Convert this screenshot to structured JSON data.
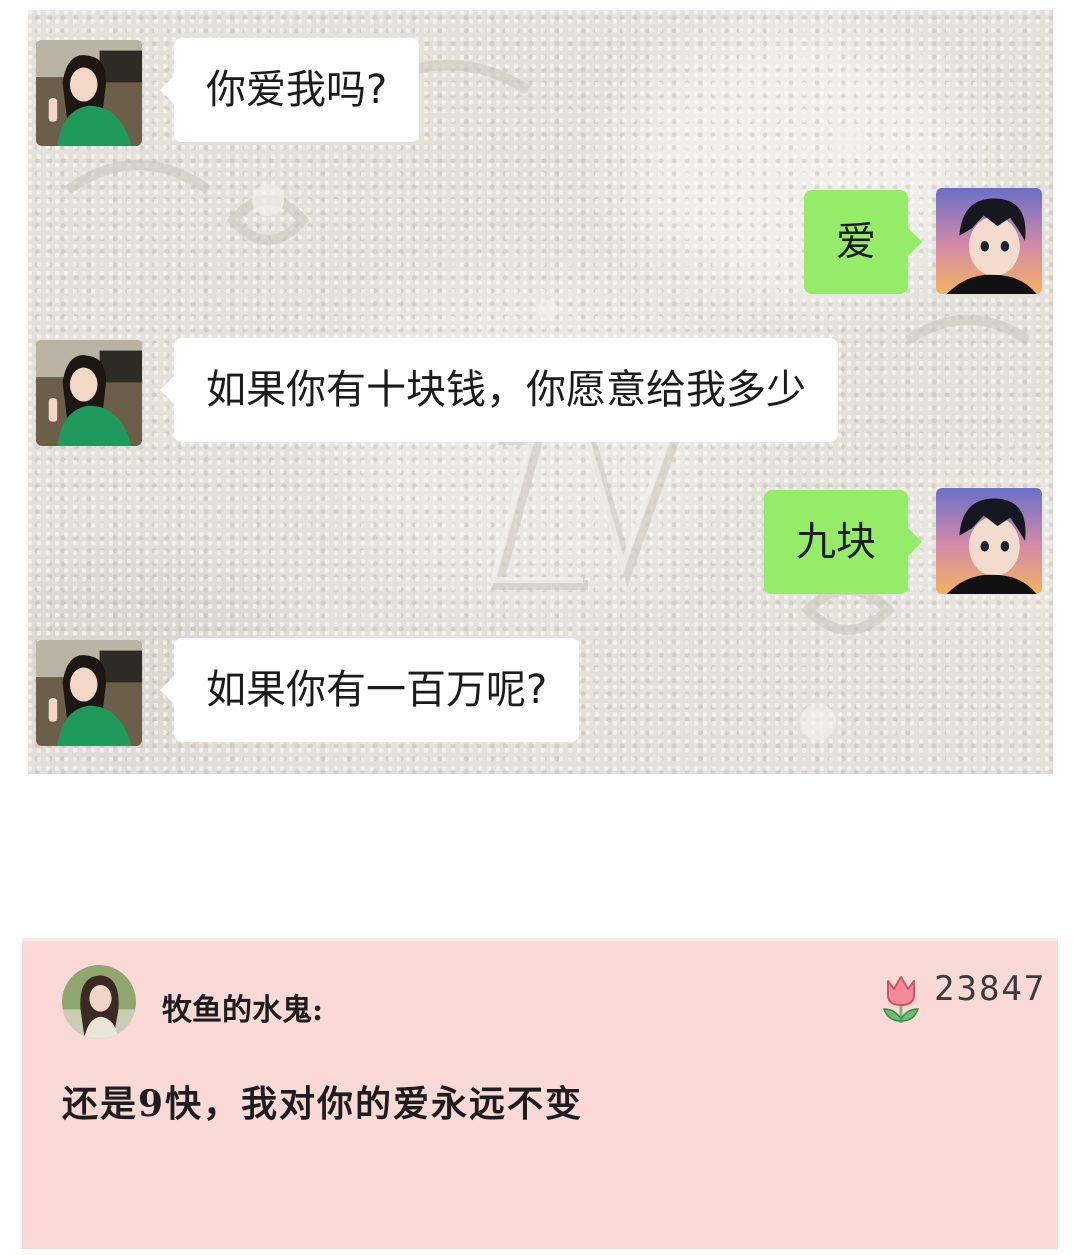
{
  "chat": {
    "messages": [
      {
        "side": "left",
        "sender": "girl",
        "text": "你爱我吗?"
      },
      {
        "side": "right",
        "sender": "boy",
        "text": "爱"
      },
      {
        "side": "left",
        "sender": "girl",
        "text": "如果你有十块钱，你愿意给我多少"
      },
      {
        "side": "right",
        "sender": "boy",
        "text": "九块"
      },
      {
        "side": "left",
        "sender": "girl",
        "text": "如果你有一百万呢?"
      }
    ]
  },
  "comment": {
    "username": "牧鱼的水鬼:",
    "like_icon": "tulip-icon",
    "like_count": "23847",
    "text": "还是9快，我对你的爱永远不变"
  },
  "colors": {
    "outgoing_bubble": "#95ec69",
    "incoming_bubble": "#ffffff",
    "comment_background": "#fbd9d6"
  }
}
